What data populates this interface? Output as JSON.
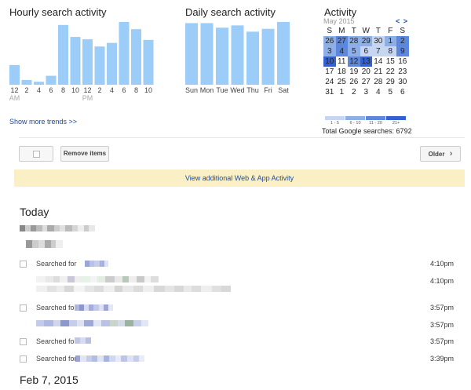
{
  "hourly": {
    "title": "Hourly search activity",
    "chart_data": {
      "type": "bar",
      "categories": [
        "12",
        "2",
        "4",
        "6",
        "8",
        "10",
        "12",
        "2",
        "4",
        "6",
        "8",
        "10"
      ],
      "values": [
        33,
        8,
        5,
        15,
        100,
        80,
        76,
        64,
        70,
        105,
        93,
        75
      ],
      "sub_labels": [
        "AM",
        "PM"
      ],
      "xlabel": "",
      "ylabel": ""
    }
  },
  "daily": {
    "title": "Daily search activity",
    "chart_data": {
      "type": "bar",
      "categories": [
        "Sun",
        "Mon",
        "Tue",
        "Wed",
        "Thu",
        "Fri",
        "Sat"
      ],
      "values": [
        108,
        108,
        100,
        104,
        93,
        98,
        110
      ],
      "xlabel": "",
      "ylabel": ""
    }
  },
  "activity": {
    "title": "Activity",
    "month": "May 2015",
    "nav": "< >",
    "weekdays": [
      "S",
      "M",
      "T",
      "W",
      "T",
      "F",
      "S"
    ],
    "weeks": [
      [
        {
          "d": "26",
          "lvl": 2
        },
        {
          "d": "27",
          "lvl": 3
        },
        {
          "d": "28",
          "lvl": 2
        },
        {
          "d": "29",
          "lvl": 2
        },
        {
          "d": "30",
          "lvl": 1
        },
        {
          "d": "1",
          "lvl": 2
        },
        {
          "d": "2",
          "lvl": 3
        }
      ],
      [
        {
          "d": "3",
          "lvl": 2
        },
        {
          "d": "4",
          "lvl": 3
        },
        {
          "d": "5",
          "lvl": 2
        },
        {
          "d": "6",
          "lvl": 1
        },
        {
          "d": "7",
          "lvl": 1
        },
        {
          "d": "8",
          "lvl": 1
        },
        {
          "d": "9",
          "lvl": 3
        }
      ],
      [
        {
          "d": "10",
          "lvl": 4
        },
        {
          "d": "11",
          "lvl": 0
        },
        {
          "d": "12",
          "lvl": 3
        },
        {
          "d": "13",
          "lvl": 4
        },
        {
          "d": "14",
          "lvl": 0
        },
        {
          "d": "15",
          "lvl": 0
        },
        {
          "d": "16",
          "lvl": 0
        }
      ],
      [
        {
          "d": "17",
          "lvl": 0
        },
        {
          "d": "18",
          "lvl": 0
        },
        {
          "d": "19",
          "lvl": 0
        },
        {
          "d": "20",
          "lvl": 0
        },
        {
          "d": "21",
          "lvl": 0
        },
        {
          "d": "22",
          "lvl": 0
        },
        {
          "d": "23",
          "lvl": 0
        }
      ],
      [
        {
          "d": "24",
          "lvl": 0
        },
        {
          "d": "25",
          "lvl": 0
        },
        {
          "d": "26",
          "lvl": 0
        },
        {
          "d": "27",
          "lvl": 0
        },
        {
          "d": "28",
          "lvl": 0
        },
        {
          "d": "29",
          "lvl": 0
        },
        {
          "d": "30",
          "lvl": 0
        }
      ],
      [
        {
          "d": "31",
          "lvl": 0
        },
        {
          "d": "1",
          "lvl": 0
        },
        {
          "d": "2",
          "lvl": 0
        },
        {
          "d": "3",
          "lvl": 0
        },
        {
          "d": "4",
          "lvl": 0
        },
        {
          "d": "5",
          "lvl": 0
        },
        {
          "d": "6",
          "lvl": 0
        }
      ]
    ],
    "level_colors": [
      "#ffffff",
      "#c6d6f1",
      "#8eaee6",
      "#5d87dc",
      "#3461cf"
    ],
    "legend": [
      "1 - 5",
      "6 - 10",
      "11 - 20",
      "21+"
    ],
    "total": "Total Google searches: 6792"
  },
  "show_more": "Show more trends >>",
  "toolbar": {
    "remove_label": "Remove items",
    "older_label": "Older",
    "older_icon": "chevron-right-icon"
  },
  "banner": "View additional Web & App Activity",
  "today": {
    "title": "Today",
    "rows": [
      {
        "label": "Searched for",
        "time": "4:10pm"
      },
      {
        "label": "",
        "time": "4:10pm"
      },
      {
        "label": "Searched for",
        "time": "3:57pm"
      },
      {
        "label": "",
        "time": "3:57pm"
      },
      {
        "label": "Searched for",
        "time": "3:57pm"
      },
      {
        "label": "Searched for",
        "time": "3:39pm"
      }
    ]
  },
  "next_day": {
    "title": "Feb 7, 2015"
  },
  "colors": {
    "bar": "#9ccdf9",
    "link": "#1a4aa5",
    "banner_bg": "#fbf0c5"
  }
}
